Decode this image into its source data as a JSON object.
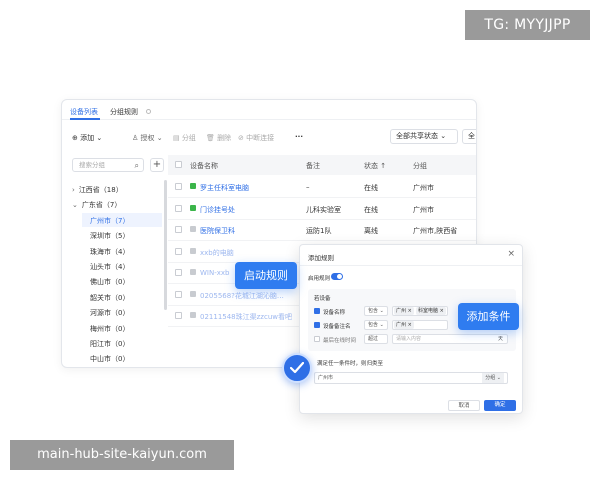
{
  "watermarks": {
    "top": "TG: MYYJJPP",
    "bottom": "main-hub-site-kaiyun.com"
  },
  "tabs": [
    {
      "label": "设备列表",
      "active": true
    },
    {
      "label": "分组规则",
      "active": false
    }
  ],
  "toolbar": {
    "add": "添加",
    "authorize": "授权",
    "group": "分组",
    "delete": "删除",
    "disconnect": "中断连接",
    "more": "···",
    "share_filter": "全部共享状态",
    "second_filter": "全"
  },
  "tree": {
    "search_placeholder": "搜索分组",
    "add_icon": "+",
    "items": [
      {
        "label": "江西省（18）",
        "arrow": "›",
        "level": 0
      },
      {
        "label": "广东省（7）",
        "arrow": "⌄",
        "level": 0
      },
      {
        "label": "广州市（7）",
        "level": 1,
        "selected": true
      },
      {
        "label": "深圳市（5）",
        "level": 1
      },
      {
        "label": "珠海市（4）",
        "level": 1
      },
      {
        "label": "汕头市（4）",
        "level": 1
      },
      {
        "label": "佛山市（0）",
        "level": 1
      },
      {
        "label": "韶关市（0）",
        "level": 1
      },
      {
        "label": "河源市（0）",
        "level": 1
      },
      {
        "label": "梅州市（0）",
        "level": 1
      },
      {
        "label": "阳江市（0）",
        "level": 1
      },
      {
        "label": "中山市（0）",
        "level": 1
      }
    ]
  },
  "table": {
    "headers": {
      "name": "设备名称",
      "remark": "备注",
      "status": "状态 ↑",
      "group": "分组"
    },
    "rows": [
      {
        "name": "罗主任科室电脑",
        "remark": "–",
        "status": "在线",
        "group": "广州市",
        "icon_color": "#3bb54a"
      },
      {
        "name": "门诊挂号处",
        "remark": "儿科实验室",
        "status": "在线",
        "group": "广州市",
        "icon_color": "#3bb54a"
      },
      {
        "name": "医院保卫科",
        "remark": "运防1队",
        "status": "离线",
        "group": "广州市,陕西省",
        "icon_color": "#c8cbd0"
      },
      {
        "name": "xxb的电脑",
        "remark": "",
        "status": "",
        "group": "",
        "icon_color": "#c8cbd0"
      },
      {
        "name": "WIN-xxb",
        "remark": "",
        "status": "",
        "group": "",
        "icon_color": "#c8cbd0"
      },
      {
        "name": "0205568?花城江湖沁脑…",
        "remark": "",
        "status": "",
        "group": "",
        "icon_color": "#c8cbd0"
      },
      {
        "name": "02111548珠江渠zzcuw看吧",
        "remark": "",
        "status": "",
        "group": "",
        "icon_color": "#c8cbd0"
      }
    ]
  },
  "dialog": {
    "title": "添加规则",
    "close": "×",
    "enable_label": "启用规则",
    "enabled": true,
    "section": "若设备",
    "conditions": [
      {
        "field": "设备名称",
        "checked": true,
        "operator": "包含",
        "chips": [
          "广州 ×",
          "科室电脑 ×"
        ]
      },
      {
        "field": "设备备注名",
        "checked": true,
        "operator": "包含",
        "chips": [
          "广州 ×"
        ]
      },
      {
        "field": "最后在线时间",
        "checked": false,
        "operator": "超过",
        "placeholder": "请输入内容",
        "unit": "天"
      }
    ],
    "then_label": "满足任一条件时，则归类至",
    "target_value": "广州市",
    "target_kind": "分组",
    "cancel": "取消",
    "ok": "确定"
  },
  "callouts": {
    "start_rule": "启动规则",
    "add_condition": "添加条件"
  },
  "colors": {
    "accent": "#2f6fe6",
    "online_icon": "#3bb54a"
  }
}
